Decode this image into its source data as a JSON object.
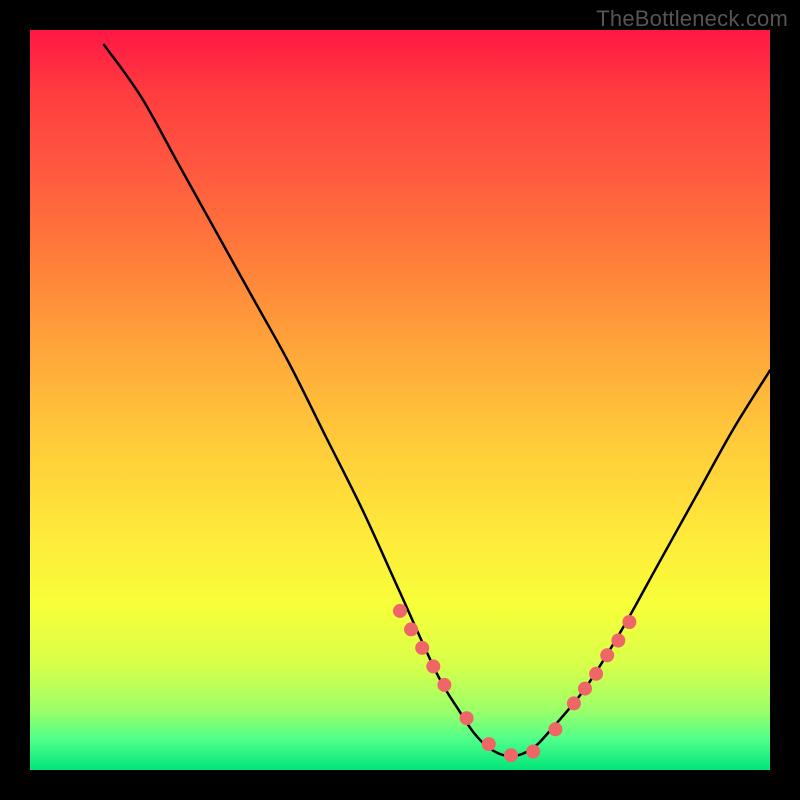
{
  "watermark": "TheBottleneck.com",
  "colors": {
    "background": "#000000",
    "curve_stroke": "#000000",
    "marker_fill": "#ef6666",
    "gradient_top": "#ff1744",
    "gradient_bottom": "#00e57a"
  },
  "chart_data": {
    "type": "line",
    "title": "",
    "xlabel": "",
    "ylabel": "",
    "xlim": [
      0,
      100
    ],
    "ylim": [
      0,
      100
    ],
    "note": "Smooth V-shaped curve with minimum near x≈63; background is a red→green vertical gradient; y increases downward visually (higher value = lower on plot). Values are visual estimates.",
    "series": [
      {
        "name": "curve",
        "x": [
          10,
          15,
          20,
          25,
          30,
          35,
          40,
          45,
          50,
          55,
          58,
          60,
          62,
          64,
          66,
          68,
          70,
          75,
          80,
          85,
          90,
          95,
          100
        ],
        "y": [
          2,
          9,
          18,
          27,
          36,
          45,
          55,
          65,
          76,
          87,
          92,
          95,
          97,
          98,
          98,
          97,
          95,
          89,
          81,
          72,
          63,
          54,
          46
        ]
      }
    ],
    "markers": {
      "name": "highlighted-points",
      "x": [
        50,
        51.5,
        53,
        54.5,
        56,
        59,
        62,
        65,
        68,
        71,
        73.5,
        75,
        76.5,
        78,
        79.5,
        81
      ],
      "y": [
        78.5,
        81,
        83.5,
        86,
        88.5,
        93,
        96.5,
        98,
        97.5,
        94.5,
        91,
        89,
        87,
        84.5,
        82.5,
        80
      ]
    }
  }
}
